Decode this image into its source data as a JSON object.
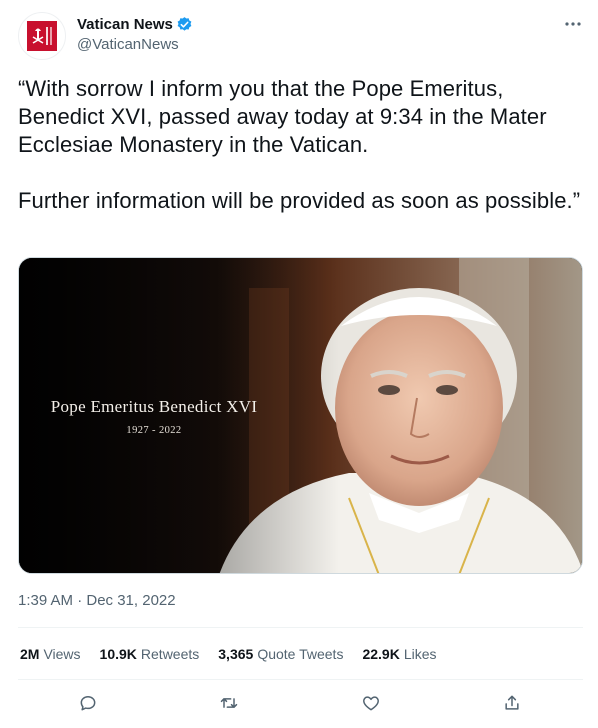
{
  "author": {
    "display_name": "Vatican News",
    "handle": "@VaticanNews",
    "avatar_icon": "vatican-news-logo",
    "verified_icon": "verified-badge-icon",
    "brand_color": "#c8102e",
    "verified_color": "#1d9bf0"
  },
  "tweet": {
    "paragraphs": [
      "“With sorrow I inform you that the Pope Emeritus, Benedict XVI, passed away today at 9:34 in the Mater Ecclesiae Monastery in the Vatican.",
      "Further information will be provided as soon as possible.”"
    ],
    "media": {
      "caption_title": "Pope Emeritus Benedict XVI",
      "caption_years": "1927 - 2022"
    },
    "timestamp": "1:39 AM · Dec 31, 2022"
  },
  "stats": [
    {
      "count": "2M",
      "label": "Views"
    },
    {
      "count": "10.9K",
      "label": "Retweets"
    },
    {
      "count": "3,365",
      "label": "Quote Tweets"
    },
    {
      "count": "22.9K",
      "label": "Likes"
    }
  ],
  "actions": [
    {
      "icon": "reply-icon"
    },
    {
      "icon": "retweet-icon"
    },
    {
      "icon": "like-icon"
    },
    {
      "icon": "share-icon"
    }
  ],
  "colors": {
    "text_primary": "#0f1419",
    "text_secondary": "#536471",
    "divider": "#eff3f4"
  }
}
